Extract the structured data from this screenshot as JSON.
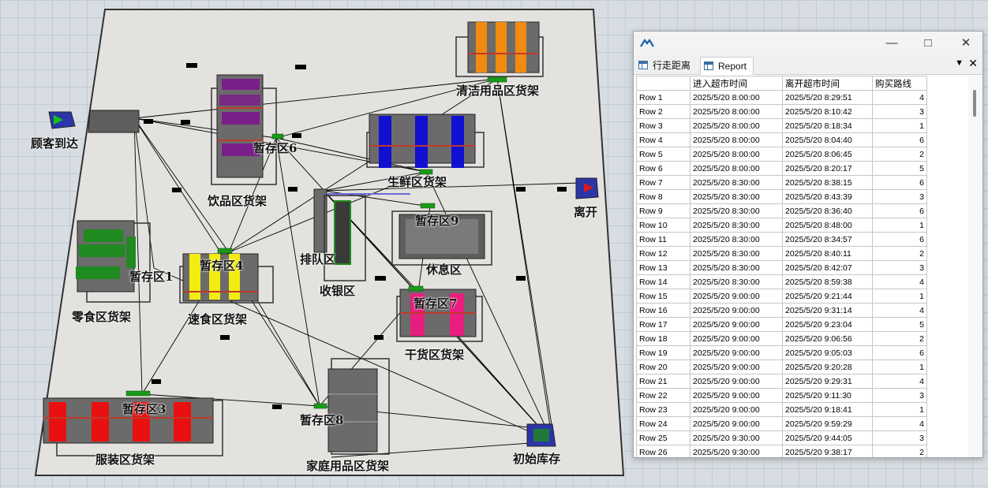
{
  "model": {
    "labels": {
      "customer_arrival": "顾客到达",
      "exit": "离开",
      "cleaning_shelf": "清洁用品区货架",
      "beverage_shelf": "饮品区货架",
      "fresh_shelf": "生鲜区货架",
      "snack_shelf": "零食区货架",
      "fastfood_shelf": "速食区货架",
      "dry_shelf": "干货区货架",
      "clothing_shelf": "服装区货架",
      "household_shelf": "家庭用品区货架",
      "queue": "排队区",
      "checkout": "收银区",
      "rest": "休息区",
      "initial_stock": "初始库存",
      "buffer1": "暂存区1",
      "buffer3": "暂存区3",
      "buffer4": "暂存区4",
      "buffer6": "暂存区6",
      "buffer7": "暂存区7",
      "buffer8": "暂存区8",
      "buffer9": "暂存区9"
    },
    "colors": {
      "floor": "#e4e2de",
      "beverage": "#7a1f8a",
      "fresh": "#1010d0",
      "snack": "#1f8a1f",
      "fastfood": "#f2ec10",
      "cleaning": "#f08a10",
      "dry": "#e81e7e",
      "clothing": "#e81010"
    }
  },
  "report": {
    "window_icon": "flexsim-logo-icon",
    "tabs": [
      {
        "label": "行走距离"
      },
      {
        "label": "Report"
      }
    ],
    "columns": [
      "",
      "进入超市时间",
      "离开超市时间",
      "购买路线"
    ],
    "rows": [
      [
        "Row 1",
        "2025/5/20 8:00:00",
        "2025/5/20 8:29:51",
        "4"
      ],
      [
        "Row 2",
        "2025/5/20 8:00:00",
        "2025/5/20 8:10:42",
        "3"
      ],
      [
        "Row 3",
        "2025/5/20 8:00:00",
        "2025/5/20 8:18:34",
        "1"
      ],
      [
        "Row 4",
        "2025/5/20 8:00:00",
        "2025/5/20 8:04:40",
        "6"
      ],
      [
        "Row 5",
        "2025/5/20 8:00:00",
        "2025/5/20 8:06:45",
        "2"
      ],
      [
        "Row 6",
        "2025/5/20 8:00:00",
        "2025/5/20 8:20:17",
        "5"
      ],
      [
        "Row 7",
        "2025/5/20 8:30:00",
        "2025/5/20 8:38:15",
        "6"
      ],
      [
        "Row 8",
        "2025/5/20 8:30:00",
        "2025/5/20 8:43:39",
        "3"
      ],
      [
        "Row 9",
        "2025/5/20 8:30:00",
        "2025/5/20 8:36:40",
        "6"
      ],
      [
        "Row 10",
        "2025/5/20 8:30:00",
        "2025/5/20 8:48:00",
        "1"
      ],
      [
        "Row 11",
        "2025/5/20 8:30:00",
        "2025/5/20 8:34:57",
        "6"
      ],
      [
        "Row 12",
        "2025/5/20 8:30:00",
        "2025/5/20 8:40:11",
        "2"
      ],
      [
        "Row 13",
        "2025/5/20 8:30:00",
        "2025/5/20 8:42:07",
        "3"
      ],
      [
        "Row 14",
        "2025/5/20 8:30:00",
        "2025/5/20 8:59:38",
        "4"
      ],
      [
        "Row 15",
        "2025/5/20 9:00:00",
        "2025/5/20 9:21:44",
        "1"
      ],
      [
        "Row 16",
        "2025/5/20 9:00:00",
        "2025/5/20 9:31:14",
        "4"
      ],
      [
        "Row 17",
        "2025/5/20 9:00:00",
        "2025/5/20 9:23:04",
        "5"
      ],
      [
        "Row 18",
        "2025/5/20 9:00:00",
        "2025/5/20 9:06:56",
        "2"
      ],
      [
        "Row 19",
        "2025/5/20 9:00:00",
        "2025/5/20 9:05:03",
        "6"
      ],
      [
        "Row 20",
        "2025/5/20 9:00:00",
        "2025/5/20 9:20:28",
        "1"
      ],
      [
        "Row 21",
        "2025/5/20 9:00:00",
        "2025/5/20 9:29:31",
        "4"
      ],
      [
        "Row 22",
        "2025/5/20 9:00:00",
        "2025/5/20 9:11:30",
        "3"
      ],
      [
        "Row 23",
        "2025/5/20 9:00:00",
        "2025/5/20 9:18:41",
        "1"
      ],
      [
        "Row 24",
        "2025/5/20 9:00:00",
        "2025/5/20 9:59:29",
        "4"
      ],
      [
        "Row 25",
        "2025/5/20 9:30:00",
        "2025/5/20 9:44:05",
        "3"
      ],
      [
        "Row 26",
        "2025/5/20 9:30:00",
        "2025/5/20 9:38:17",
        "2"
      ]
    ]
  }
}
